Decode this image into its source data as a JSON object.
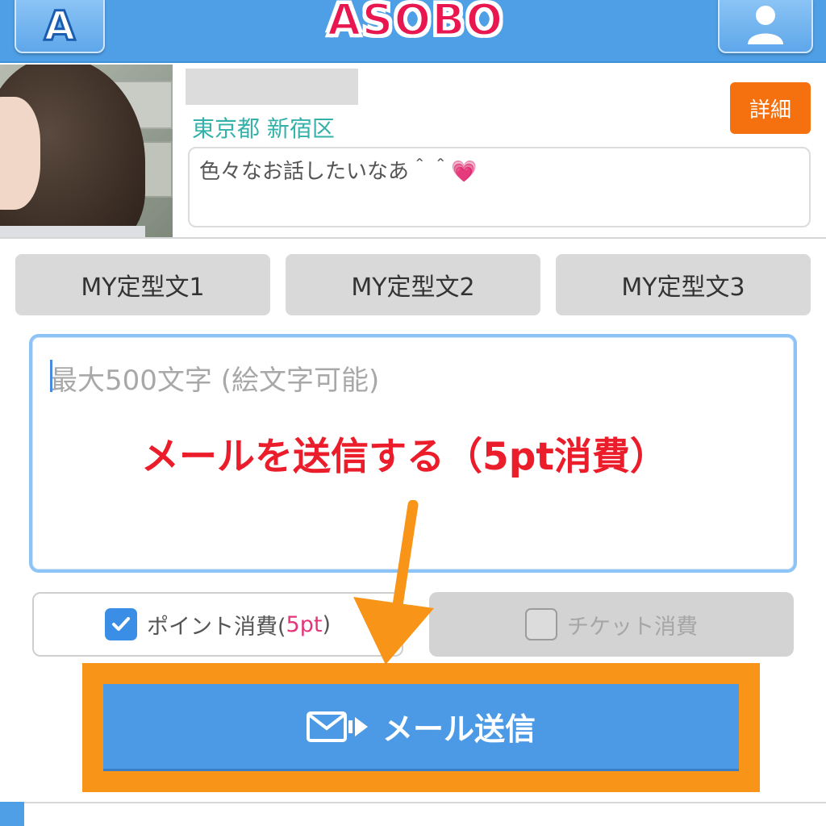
{
  "header": {
    "left_button_letter": "A",
    "logo_text": "ASOBO",
    "user_icon": "user-icon",
    "colors": {
      "header_bg": "#4f9fe6",
      "logo": "#e8174f"
    }
  },
  "profile": {
    "location": "東京都 新宿区",
    "detail_label": "詳細",
    "bio": "色々なお話したいなあ＾＾",
    "bio_emoji": "💗"
  },
  "templates": [
    "MY定型文1",
    "MY定型文2",
    "MY定型文3"
  ],
  "message": {
    "placeholder": "最大500文字 (絵文字可能)",
    "annotation": "メールを送信する（5pt消費）"
  },
  "options": {
    "point_label": "ポイント消費(",
    "point_value": "5pt",
    "point_close": ")",
    "point_checked": true,
    "ticket_label": "チケット消費",
    "ticket_checked": false
  },
  "send": {
    "label": "メール送信",
    "colors": {
      "frame": "#f89418",
      "button": "#4c9ae5"
    }
  }
}
